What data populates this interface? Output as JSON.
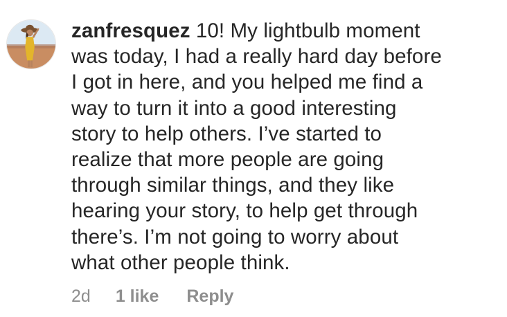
{
  "comment": {
    "username": "zanfresquez",
    "text": "10! My lightbulb moment\nwas today, I had a really hard day before\nI got in here, and you helped me find a\nway to turn it into a good interesting\nstory to help others. I’ve started to\nrealize that more people are going\nthrough similar things, and they like\nhearing your story, to help get through\nthere’s. I’m not going to worry about\nwhat other people think.",
    "time": "2d",
    "likes": "1 like",
    "reply_label": "Reply"
  },
  "avatar": {
    "icon": "user-avatar-photo",
    "colors": {
      "sky": "#dce9f3",
      "ground": "#c98d62",
      "dress": "#e3b52b",
      "skin": "#b8835e",
      "hat": "#7a5230"
    }
  },
  "colors": {
    "text": "#262626",
    "meta": "#8e8e8e",
    "background": "#ffffff"
  }
}
